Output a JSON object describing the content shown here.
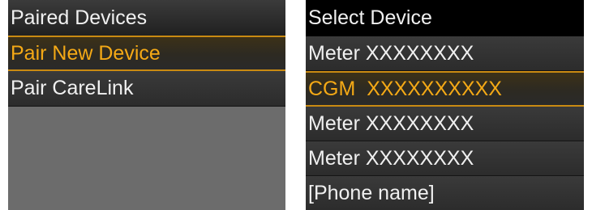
{
  "paired_devices_screen": {
    "title": "Paired Devices",
    "items": [
      {
        "label": "Pair New Device",
        "selected": true
      },
      {
        "label": "Pair CareLink",
        "selected": false
      }
    ]
  },
  "select_device_screen": {
    "title": "Select Device",
    "items": [
      {
        "label": "Meter XXXXXXXX",
        "selected": false
      },
      {
        "label": "CGM  XXXXXXXXXX",
        "selected": true
      },
      {
        "label": "Meter XXXXXXXX",
        "selected": false
      },
      {
        "label": "Meter XXXXXXXX",
        "selected": false
      },
      {
        "label": "[Phone name]",
        "selected": false
      }
    ]
  },
  "colors": {
    "highlight_text": "#f4a916",
    "highlight_border": "#c98a12",
    "normal_text": "#f0f0f0",
    "empty_area": "#6c6c6c"
  }
}
